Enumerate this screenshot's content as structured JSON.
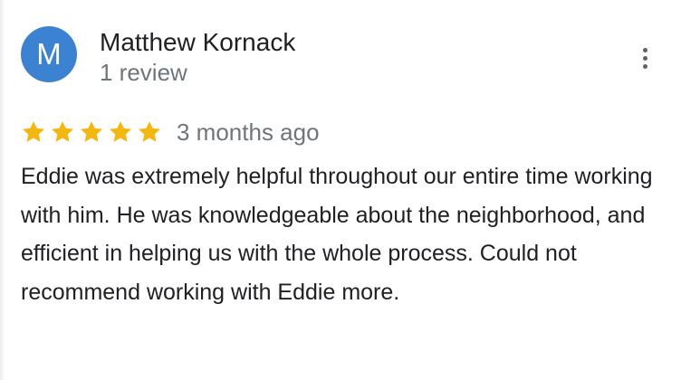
{
  "reviewer": {
    "initial": "M",
    "name": "Matthew Kornack",
    "review_count": "1 review",
    "avatar_color": "#3c82d2"
  },
  "menu": {
    "icon": "more-vert-icon"
  },
  "review": {
    "stars": 5,
    "star_color": "#f5b60e",
    "date": "3 months ago",
    "text": "Eddie was extremely helpful throughout our entire time working with him. He was knowledgeable about the neighborhood, and efficient in helping us with the whole process. Could not recommend working with Eddie more."
  }
}
